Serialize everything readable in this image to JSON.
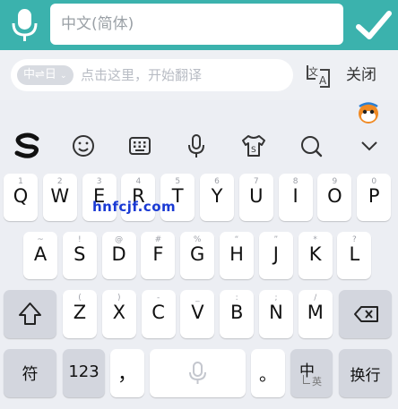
{
  "colors": {
    "accent": "#3bb2ad",
    "background": "#eceef3",
    "key": "#ffffff",
    "function_key": "#d3d6de"
  },
  "top": {
    "input_placeholder": "中文(简体)",
    "mic_icon": "microphone-icon",
    "confirm_icon": "checkmark-icon"
  },
  "translate": {
    "lang_pair": "中⇌日",
    "placeholder": "点击这里，开始翻译",
    "close_label": "关闭",
    "translate_icon": "translate-icon"
  },
  "toolbar": {
    "icons": [
      "sogou-logo-icon",
      "emoji-icon",
      "keyboard-icon",
      "microphone-icon",
      "skin-shirt-icon",
      "search-icon",
      "chevron-down-icon"
    ]
  },
  "watermark": "hnfcjf.com",
  "keyboard": {
    "row1": [
      {
        "main": "Q",
        "sub": "1"
      },
      {
        "main": "W",
        "sub": "2"
      },
      {
        "main": "E",
        "sub": "3"
      },
      {
        "main": "R",
        "sub": "4"
      },
      {
        "main": "T",
        "sub": "5"
      },
      {
        "main": "Y",
        "sub": "6"
      },
      {
        "main": "U",
        "sub": "7"
      },
      {
        "main": "I",
        "sub": "8"
      },
      {
        "main": "O",
        "sub": "9"
      },
      {
        "main": "P",
        "sub": "0"
      }
    ],
    "row2": [
      {
        "main": "A",
        "sub": "~"
      },
      {
        "main": "S",
        "sub": "!"
      },
      {
        "main": "D",
        "sub": "@"
      },
      {
        "main": "F",
        "sub": "#"
      },
      {
        "main": "G",
        "sub": "%"
      },
      {
        "main": "H",
        "sub": "“"
      },
      {
        "main": "J",
        "sub": "”"
      },
      {
        "main": "K",
        "sub": "*"
      },
      {
        "main": "L",
        "sub": "?"
      }
    ],
    "row3": [
      {
        "main": "Z",
        "sub": "("
      },
      {
        "main": "X",
        "sub": ")"
      },
      {
        "main": "C",
        "sub": "-"
      },
      {
        "main": "V",
        "sub": "_"
      },
      {
        "main": "B",
        "sub": ":"
      },
      {
        "main": "N",
        "sub": ";"
      },
      {
        "main": "M",
        "sub": "/"
      }
    ],
    "bottom": {
      "symbol_label": "符",
      "number_label": "123",
      "comma_label": "，",
      "period_label": "。",
      "lang_main": "中",
      "lang_sub": "英",
      "enter_label": "换行"
    }
  }
}
